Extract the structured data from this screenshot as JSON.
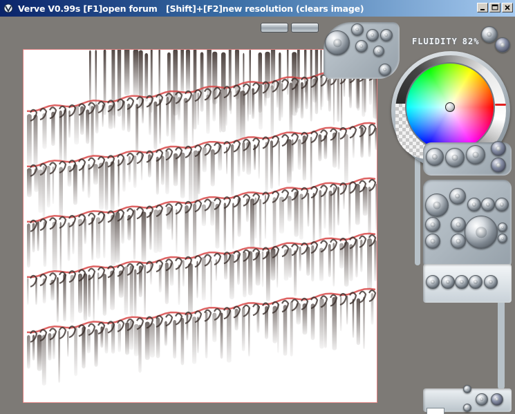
{
  "window": {
    "title": "Verve V0.99s [F1]open forum   [Shift]+[F2]new resolution (clears image)",
    "buttons": [
      "minimize",
      "maximize",
      "close"
    ]
  },
  "panel": {
    "fluidity_label": "FLUIDITY",
    "fluidity_value": "82%"
  },
  "colors": {
    "titlebar_start": "#0a246a",
    "titlebar_end": "#a6caf0",
    "background": "#7d7a76",
    "canvas_border": "#e08080",
    "stroke_dark": "#3a2e2a",
    "stroke_red": "#d84848",
    "selected_color": "#ffffff"
  },
  "icons": {
    "app": "verve-app-icon",
    "minimize": "minimize-icon",
    "maximize": "maximize-icon",
    "close": "close-icon"
  }
}
